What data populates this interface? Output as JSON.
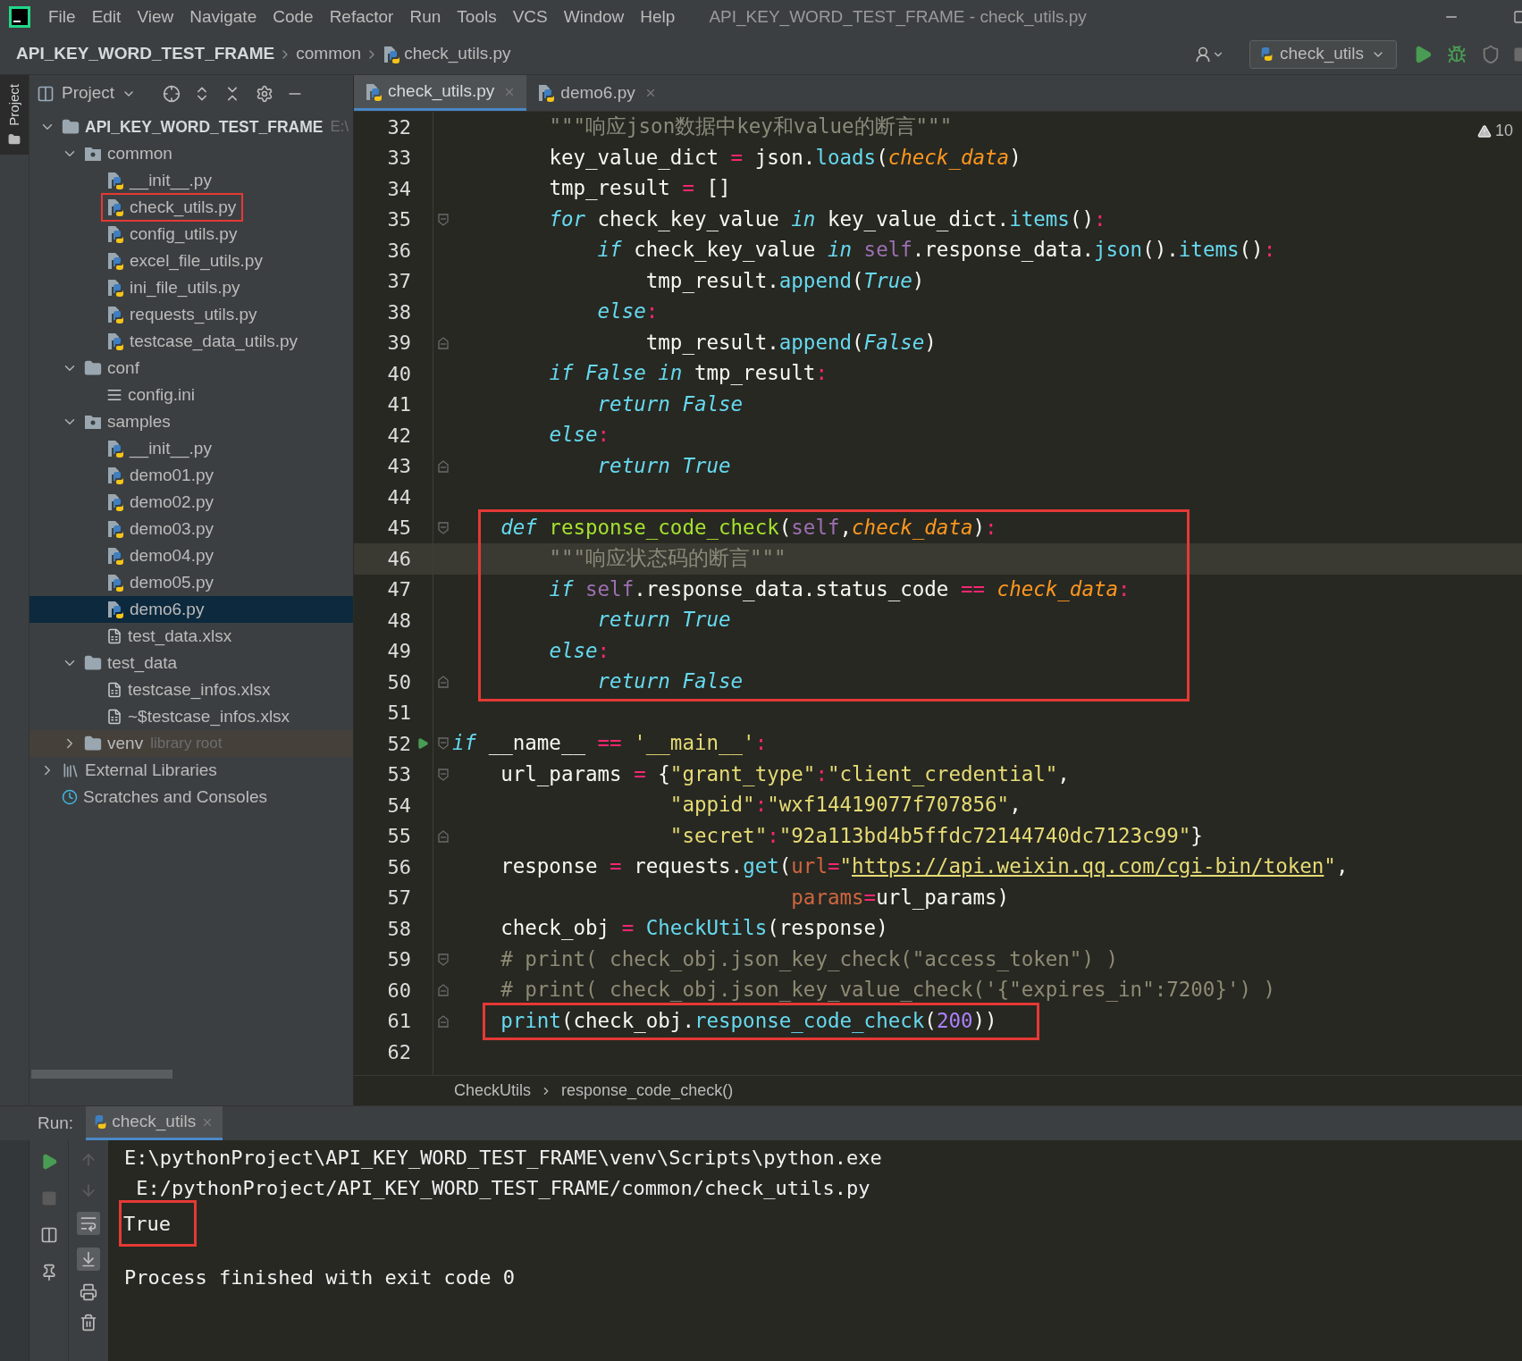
{
  "window": {
    "title": "API_KEY_WORD_TEST_FRAME - check_utils.py"
  },
  "menu": [
    "File",
    "Edit",
    "View",
    "Navigate",
    "Code",
    "Refactor",
    "Run",
    "Tools",
    "VCS",
    "Window",
    "Help"
  ],
  "nav_path": [
    "API_KEY_WORD_TEST_FRAME",
    "common",
    "check_utils.py"
  ],
  "run_config": "check_utils",
  "side_tab": "Project",
  "project_panel": {
    "title": "Project"
  },
  "tree": [
    {
      "label": "API_KEY_WORD_TEST_FRAME",
      "hint": "E:\\",
      "kind": "project",
      "expanded": true,
      "selected": false,
      "boxed": false,
      "children": [
        {
          "label": "common",
          "kind": "module_folder",
          "expanded": true,
          "selected": false,
          "boxed": false,
          "children": [
            {
              "label": "__init__.py",
              "kind": "py",
              "selected": false,
              "boxed": false
            },
            {
              "label": "check_utils.py",
              "kind": "py",
              "selected": false,
              "boxed": true
            },
            {
              "label": "config_utils.py",
              "kind": "py",
              "selected": false,
              "boxed": false
            },
            {
              "label": "excel_file_utils.py",
              "kind": "py",
              "selected": false,
              "boxed": false
            },
            {
              "label": "ini_file_utils.py",
              "kind": "py",
              "selected": false,
              "boxed": false
            },
            {
              "label": "requests_utils.py",
              "kind": "py",
              "selected": false,
              "boxed": false
            },
            {
              "label": "testcase_data_utils.py",
              "kind": "py",
              "selected": false,
              "boxed": false
            }
          ]
        },
        {
          "label": "conf",
          "kind": "folder",
          "expanded": true,
          "selected": false,
          "boxed": false,
          "children": [
            {
              "label": "config.ini",
              "kind": "ini",
              "selected": false,
              "boxed": false
            }
          ]
        },
        {
          "label": "samples",
          "kind": "module_folder",
          "expanded": true,
          "selected": false,
          "boxed": false,
          "children": [
            {
              "label": "__init__.py",
              "kind": "py",
              "selected": false,
              "boxed": false
            },
            {
              "label": "demo01.py",
              "kind": "py",
              "selected": false,
              "boxed": false
            },
            {
              "label": "demo02.py",
              "kind": "py",
              "selected": false,
              "boxed": false
            },
            {
              "label": "demo03.py",
              "kind": "py",
              "selected": false,
              "boxed": false
            },
            {
              "label": "demo04.py",
              "kind": "py",
              "selected": false,
              "boxed": false
            },
            {
              "label": "demo05.py",
              "kind": "py",
              "selected": false,
              "boxed": false
            },
            {
              "label": "demo6.py",
              "kind": "py",
              "selected": true,
              "boxed": false
            },
            {
              "label": "test_data.xlsx",
              "kind": "xlsx",
              "selected": false,
              "boxed": false
            }
          ]
        },
        {
          "label": "test_data",
          "kind": "folder",
          "expanded": true,
          "selected": false,
          "boxed": false,
          "children": [
            {
              "label": "testcase_infos.xlsx",
              "kind": "xlsx",
              "selected": false,
              "boxed": false
            },
            {
              "label": "~$testcase_infos.xlsx",
              "kind": "xlsx",
              "selected": false,
              "boxed": false
            }
          ]
        },
        {
          "label": "venv",
          "hint": "library root",
          "kind": "library_folder",
          "expanded": false,
          "selected": false,
          "boxed": false
        }
      ]
    },
    {
      "label": "External Libraries",
      "kind": "libraries",
      "expanded": false,
      "selected": false,
      "boxed": false
    },
    {
      "label": "Scratches and Consoles",
      "kind": "scratches",
      "selected": false,
      "boxed": false
    }
  ],
  "editor_tabs": [
    {
      "label": "check_utils.py",
      "selected": true
    },
    {
      "label": "demo6.py",
      "selected": false
    }
  ],
  "warnings": "10",
  "code": [
    {
      "n": "32",
      "current": false,
      "t": [
        {
          "kind": "doc",
          "text": "        \"\"\"响应json数据中key和value的断言\"\"\""
        }
      ]
    },
    {
      "n": "33",
      "current": false,
      "t": [
        {
          "kind": "p",
          "text": "        key_value_dict "
        },
        {
          "kind": "op",
          "text": "="
        },
        {
          "kind": "p",
          "text": " json."
        },
        {
          "kind": "call",
          "text": "loads"
        },
        {
          "kind": "p",
          "text": "("
        },
        {
          "kind": "param",
          "text": "check_data"
        },
        {
          "kind": "p",
          "text": ")"
        }
      ]
    },
    {
      "n": "34",
      "current": false,
      "t": [
        {
          "kind": "p",
          "text": "        tmp_result "
        },
        {
          "kind": "op",
          "text": "="
        },
        {
          "kind": "p",
          "text": " []"
        }
      ]
    },
    {
      "n": "35",
      "fold": {
        "kind": "start"
      },
      "current": false,
      "t": [
        {
          "kind": "kw",
          "text": "        for"
        },
        {
          "kind": "p",
          "text": " check_key_value "
        },
        {
          "kind": "kw",
          "text": "in"
        },
        {
          "kind": "p",
          "text": " key_value_dict."
        },
        {
          "kind": "call",
          "text": "items"
        },
        {
          "kind": "p",
          "text": "()"
        },
        {
          "kind": "op",
          "text": ":"
        }
      ]
    },
    {
      "n": "36",
      "current": false,
      "t": [
        {
          "kind": "kw",
          "text": "            if"
        },
        {
          "kind": "p",
          "text": " check_key_value "
        },
        {
          "kind": "kw",
          "text": "in"
        },
        {
          "kind": "self",
          "text": " self"
        },
        {
          "kind": "p",
          "text": ".response_data."
        },
        {
          "kind": "call",
          "text": "json"
        },
        {
          "kind": "p",
          "text": "()."
        },
        {
          "kind": "call",
          "text": "items"
        },
        {
          "kind": "p",
          "text": "()"
        },
        {
          "kind": "op",
          "text": ":"
        }
      ]
    },
    {
      "n": "37",
      "current": false,
      "t": [
        {
          "kind": "p",
          "text": "                tmp_result."
        },
        {
          "kind": "call",
          "text": "append"
        },
        {
          "kind": "p",
          "text": "("
        },
        {
          "kind": "kw",
          "text": "True"
        },
        {
          "kind": "p",
          "text": ")"
        }
      ]
    },
    {
      "n": "38",
      "current": false,
      "t": [
        {
          "kind": "kw",
          "text": "            else"
        },
        {
          "kind": "op",
          "text": ":"
        }
      ]
    },
    {
      "n": "39",
      "fold": {
        "kind": "end"
      },
      "current": false,
      "t": [
        {
          "kind": "p",
          "text": "                tmp_result."
        },
        {
          "kind": "call",
          "text": "append"
        },
        {
          "kind": "p",
          "text": "("
        },
        {
          "kind": "kw",
          "text": "False"
        },
        {
          "kind": "p",
          "text": ")"
        }
      ]
    },
    {
      "n": "40",
      "current": false,
      "t": [
        {
          "kind": "kw",
          "text": "        if"
        },
        {
          "kind": "kw",
          "text": " False"
        },
        {
          "kind": "kw",
          "text": " in"
        },
        {
          "kind": "p",
          "text": " tmp_result"
        },
        {
          "kind": "op",
          "text": ":"
        }
      ]
    },
    {
      "n": "41",
      "current": false,
      "t": [
        {
          "kind": "kw",
          "text": "            return"
        },
        {
          "kind": "kw",
          "text": " False"
        }
      ]
    },
    {
      "n": "42",
      "current": false,
      "t": [
        {
          "kind": "kw",
          "text": "        else"
        },
        {
          "kind": "op",
          "text": ":"
        }
      ]
    },
    {
      "n": "43",
      "fold": {
        "kind": "end"
      },
      "current": false,
      "t": [
        {
          "kind": "kw",
          "text": "            return"
        },
        {
          "kind": "kw",
          "text": " True"
        }
      ]
    },
    {
      "n": "44",
      "current": false
    },
    {
      "n": "45",
      "fold": {
        "kind": "start"
      },
      "current": false,
      "t": [
        {
          "kind": "kw",
          "text": "    def"
        },
        {
          "kind": "fn",
          "text": " response_code_check"
        },
        {
          "kind": "p",
          "text": "("
        },
        {
          "kind": "self",
          "text": "self"
        },
        {
          "kind": "p",
          "text": ","
        },
        {
          "kind": "param",
          "text": "check_data"
        },
        {
          "kind": "p",
          "text": ")"
        },
        {
          "kind": "op",
          "text": ":"
        }
      ]
    },
    {
      "n": "46",
      "current": true,
      "t": [
        {
          "kind": "doc",
          "text": "        \"\"\"响应状态码的断言\"\"\""
        }
      ]
    },
    {
      "n": "47",
      "current": false,
      "t": [
        {
          "kind": "kw",
          "text": "        if"
        },
        {
          "kind": "self",
          "text": " self"
        },
        {
          "kind": "p",
          "text": ".response_data.status_code "
        },
        {
          "kind": "op",
          "text": "=="
        },
        {
          "kind": "param",
          "text": " check_data"
        },
        {
          "kind": "op",
          "text": ":"
        }
      ]
    },
    {
      "n": "48",
      "current": false,
      "t": [
        {
          "kind": "kw",
          "text": "            return"
        },
        {
          "kind": "kw",
          "text": " True"
        }
      ]
    },
    {
      "n": "49",
      "current": false,
      "t": [
        {
          "kind": "kw",
          "text": "        else"
        },
        {
          "kind": "op",
          "text": ":"
        }
      ]
    },
    {
      "n": "50",
      "fold": {
        "kind": "end"
      },
      "current": false,
      "t": [
        {
          "kind": "kw",
          "text": "            return"
        },
        {
          "kind": "kw",
          "text": " False"
        }
      ]
    },
    {
      "n": "51",
      "current": false
    },
    {
      "n": "52",
      "fold": {
        "kind": "start"
      },
      "current": false,
      "run": true,
      "t": [
        {
          "kind": "kw",
          "text": "if"
        },
        {
          "kind": "p",
          "text": " __name__ "
        },
        {
          "kind": "op",
          "text": "=="
        },
        {
          "kind": "str",
          "text": " '__main__'"
        },
        {
          "kind": "op",
          "text": ":"
        }
      ]
    },
    {
      "n": "53",
      "fold": {
        "kind": "start"
      },
      "current": false,
      "t": [
        {
          "kind": "p",
          "text": "    url_params "
        },
        {
          "kind": "op",
          "text": "="
        },
        {
          "kind": "p",
          "text": " {"
        },
        {
          "kind": "str",
          "text": "\"grant_type\""
        },
        {
          "kind": "op",
          "text": ":"
        },
        {
          "kind": "str",
          "text": "\"client_credential\""
        },
        {
          "kind": "p",
          "text": ","
        }
      ]
    },
    {
      "n": "54",
      "current": false,
      "t": [
        {
          "kind": "str",
          "text": "                  \"appid\""
        },
        {
          "kind": "op",
          "text": ":"
        },
        {
          "kind": "str",
          "text": "\"wxf14419077f707856\""
        },
        {
          "kind": "p",
          "text": ","
        }
      ]
    },
    {
      "n": "55",
      "fold": {
        "kind": "end"
      },
      "current": false,
      "t": [
        {
          "kind": "str",
          "text": "                  \"secret\""
        },
        {
          "kind": "op",
          "text": ":"
        },
        {
          "kind": "str",
          "text": "\"92a113bd4b5ffdc72144740dc7123c99\""
        },
        {
          "kind": "p",
          "text": "}"
        }
      ]
    },
    {
      "n": "56",
      "current": false,
      "t": [
        {
          "kind": "p",
          "text": "    response "
        },
        {
          "kind": "op",
          "text": "="
        },
        {
          "kind": "p",
          "text": " requests."
        },
        {
          "kind": "call",
          "text": "get"
        },
        {
          "kind": "p",
          "text": "("
        },
        {
          "kind": "kwarg",
          "text": "url"
        },
        {
          "kind": "op",
          "text": "="
        },
        {
          "kind": "str",
          "text": "\""
        },
        {
          "kind": "url",
          "text": "https://api.weixin.qq.com/cgi-bin/token"
        },
        {
          "kind": "str",
          "text": "\""
        },
        {
          "kind": "p",
          "text": ","
        }
      ]
    },
    {
      "n": "57",
      "current": false,
      "t": [
        {
          "kind": "kwarg",
          "text": "                            params"
        },
        {
          "kind": "op",
          "text": "="
        },
        {
          "kind": "p",
          "text": "url_params)"
        }
      ]
    },
    {
      "n": "58",
      "current": false,
      "t": [
        {
          "kind": "p",
          "text": "    check_obj "
        },
        {
          "kind": "op",
          "text": "="
        },
        {
          "kind": "call",
          "text": " CheckUtils"
        },
        {
          "kind": "p",
          "text": "(response)"
        }
      ]
    },
    {
      "n": "59",
      "fold": {
        "kind": "start"
      },
      "current": false,
      "t": [
        {
          "kind": "cmt",
          "text": "    # print( check_obj.json_key_check(\"access_token\") )"
        }
      ]
    },
    {
      "n": "60",
      "fold": {
        "kind": "end"
      },
      "current": false,
      "t": [
        {
          "kind": "cmt",
          "text": "    # print( check_obj.json_key_value_check('{\"expires_in\":7200}') )"
        }
      ]
    },
    {
      "n": "61",
      "fold": {
        "kind": "end"
      },
      "current": false,
      "boxed": true,
      "t": [
        {
          "kind": "call",
          "text": "    print"
        },
        {
          "kind": "p",
          "text": "(check_obj."
        },
        {
          "kind": "call",
          "text": "response_code_check"
        },
        {
          "kind": "p",
          "text": "("
        },
        {
          "kind": "num",
          "text": "200"
        },
        {
          "kind": "p",
          "text": "))"
        }
      ]
    },
    {
      "n": "62",
      "current": false
    }
  ],
  "code_breadcrumb": [
    "CheckUtils",
    "response_code_check()"
  ],
  "run_panel": {
    "label": "Run:",
    "tabs": [
      {
        "label": "check_utils",
        "selected": true
      }
    ],
    "output": [
      {
        "kind": "cmd",
        "text": "E:\\pythonProject\\API_KEY_WORD_TEST_FRAME\\venv\\Scripts\\python.exe",
        "boxed": false
      },
      {
        "kind": "cmd",
        "text": " E:/pythonProject/API_KEY_WORD_TEST_FRAME/common/check_utils.py",
        "boxed": false
      },
      {
        "kind": "out",
        "text": "True",
        "boxed": true
      },
      {
        "kind": "exit",
        "text": "Process finished with exit code 0",
        "boxed": false
      }
    ]
  }
}
